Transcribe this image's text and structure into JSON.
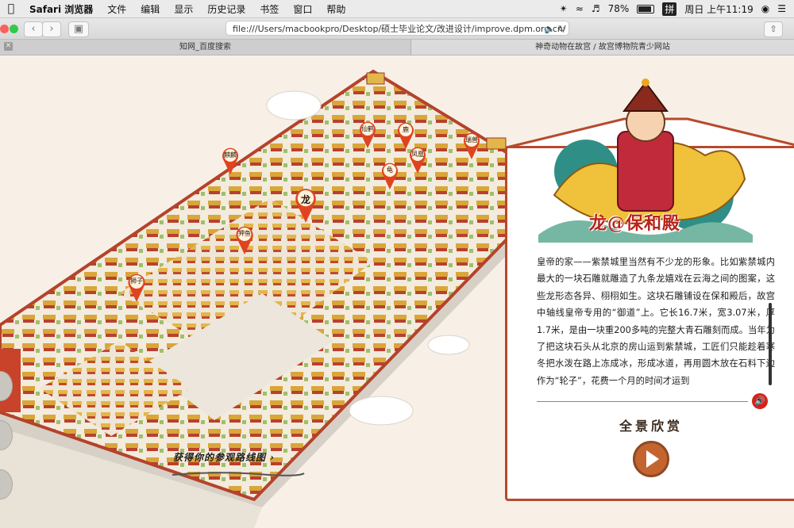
{
  "menubar": {
    "apple": "",
    "items": [
      "Safari 浏览器",
      "文件",
      "编辑",
      "显示",
      "历史记录",
      "书签",
      "窗口",
      "帮助"
    ],
    "battery": "78%",
    "input_method": "拼",
    "clock": "周日 上午11:19"
  },
  "toolbar": {
    "back": "‹",
    "forward": "›",
    "url": "file:///Users/macbookpro/Desktop/硕士毕业论文/改进设计/improve.dpm.org.cn/",
    "share": "⇧"
  },
  "tabs": [
    {
      "label": "知网_百度搜索"
    },
    {
      "label": "神奇动物在故宫 / 故宫博物院青少网站"
    }
  ],
  "map": {
    "pins": [
      {
        "label": "麒麟"
      },
      {
        "label": "仙鹤"
      },
      {
        "label": "鹿"
      },
      {
        "label": "瑞兽"
      },
      {
        "label": "龟"
      },
      {
        "label": "凤凰"
      },
      {
        "label": "龙"
      },
      {
        "label": "狎鱼"
      },
      {
        "label": "狮子"
      }
    ],
    "route_link": "获得你的参观路线图 ›"
  },
  "panel": {
    "title": "龙@保和殿",
    "description": "皇帝的家——紫禁城里当然有不少龙的形象。比如紫禁城内最大的一块石雕就雕造了九条龙嬉戏在云海之间的图案，这些龙形态各异、栩栩如生。这块石雕铺设在保和殿后，故宫中轴线皇帝专用的“御道”上。它长16.7米，宽3.07米，厚1.7米，是由一块重200多吨的完整大青石雕刻而成。当年为了把这块石头从北京的房山运到紫禁城，工匠们只能趁着寒冬把水泼在路上冻成冰，形成冰道，再用圆木放在石料下边作为“轮子”，花费一个月的时间才运到",
    "panorama_label": "全景欣赏"
  },
  "colors": {
    "accent": "#b64a2d",
    "pin": "#e0431f",
    "wall": "#c8432a",
    "roof": "#e3b84a"
  }
}
